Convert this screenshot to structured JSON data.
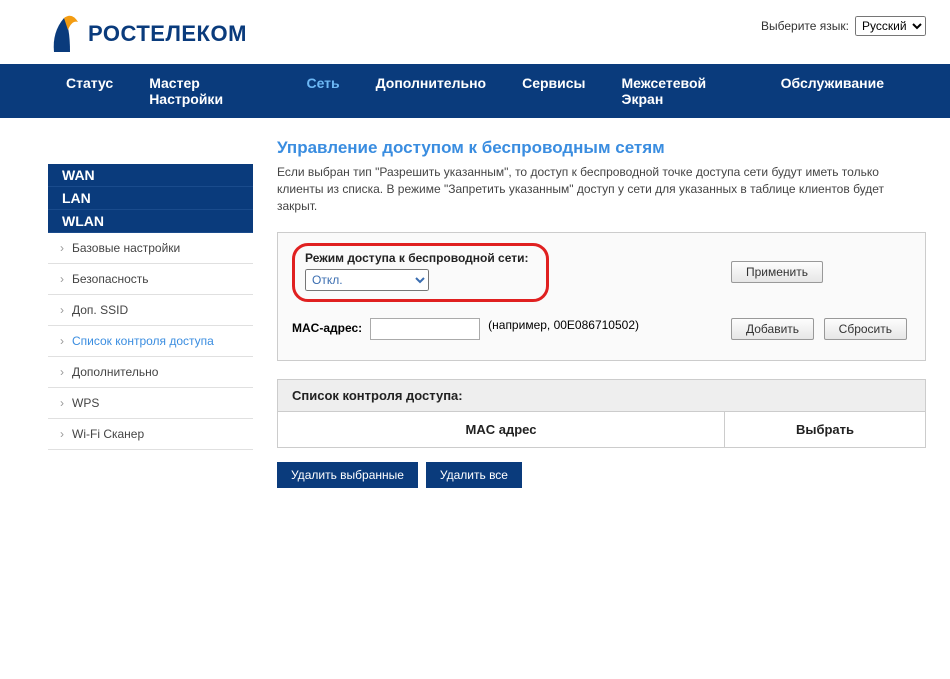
{
  "header": {
    "brand": "РОСТЕЛЕКОМ",
    "lang_label": "Выберите язык:",
    "lang_value": "Русский"
  },
  "topnav": {
    "items": [
      {
        "label": "Статус"
      },
      {
        "label": "Мастер Настройки"
      },
      {
        "label": "Сеть",
        "active": true
      },
      {
        "label": "Дополнительно"
      },
      {
        "label": "Сервисы"
      },
      {
        "label": "Межсетевой Экран"
      },
      {
        "label": "Обслуживание"
      }
    ]
  },
  "sidebar": {
    "tabs": [
      {
        "label": "WAN"
      },
      {
        "label": "LAN"
      },
      {
        "label": "WLAN",
        "expanded": true
      }
    ],
    "sub": [
      {
        "label": "Базовые настройки"
      },
      {
        "label": "Безопасность"
      },
      {
        "label": "Доп. SSID"
      },
      {
        "label": "Список контроля доступа",
        "active": true
      },
      {
        "label": "Дополнительно"
      },
      {
        "label": "WPS"
      },
      {
        "label": "Wi-Fi Сканер"
      }
    ]
  },
  "content": {
    "title": "Управление доступом к беспроводным сетям",
    "desc": "Если выбран тип \"Разрешить указанным\", то доступ к беспроводной точке доступа сети будут иметь только клиенты из списка. В режиме \"Запретить указанным\" доступ у сети для указанных в таблице клиентов будет закрыт.",
    "mode_label": "Режим доступа к беспроводной сети:",
    "mode_value": "Откл.",
    "apply_btn": "Применить",
    "mac_label": "MAC-адрес:",
    "mac_value": "",
    "mac_example": "(например, 00E086710502)",
    "add_btn": "Добавить",
    "reset_btn": "Сбросить",
    "acl_title": "Список контроля доступа:",
    "col_mac": "MAC адрес",
    "col_select": "Выбрать",
    "del_selected": "Удалить выбранные",
    "del_all": "Удалить все"
  }
}
